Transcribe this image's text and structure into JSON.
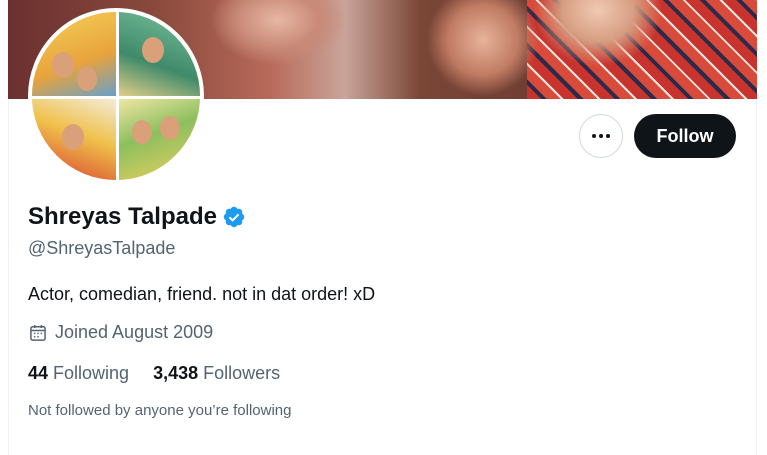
{
  "profile": {
    "name": "Shreyas Talpade",
    "handle": "@ShreyasTalpade",
    "bio": "Actor, comedian, friend. not in dat order! xD",
    "joined": "Joined August 2009",
    "verified_color": "#1d9bf0"
  },
  "stats": {
    "following_count": "44",
    "following_label": "Following",
    "followers_count": "3,438",
    "followers_label": "Followers"
  },
  "social_context": "Not followed by anyone you’re following",
  "actions": {
    "follow_label": "Follow",
    "more_icon": "ellipsis-icon"
  },
  "colors": {
    "primary_text": "#0f1419",
    "secondary_text": "#536471",
    "follow_bg": "#0f1419"
  }
}
